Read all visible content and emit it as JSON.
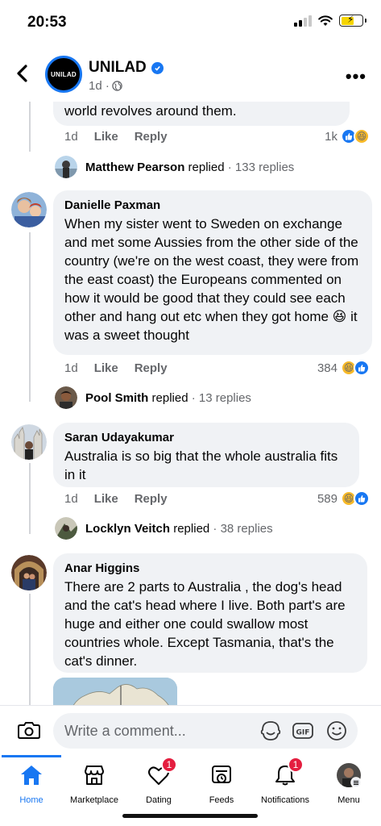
{
  "status_bar": {
    "time": "20:53"
  },
  "header": {
    "page_name": "UNILAD",
    "avatar_text": "UNILAD",
    "meta": "1d ·"
  },
  "comments": [
    {
      "text_fragment": "world revolves around them.",
      "age": "1d",
      "like": "Like",
      "reply": "Reply",
      "reactions_count": "1k",
      "reply_summary": {
        "name": "Matthew Pearson",
        "verb": "replied",
        "count": "· 133 replies"
      }
    },
    {
      "author": "Danielle Paxman",
      "text": "When my sister went to Sweden on exchange and met some Aussies from the other side of the country (we're on the west coast, they were from the east coast) the Europeans commented on how it would be good that they could see each other and hang out etc when they got home 😆 it was a sweet thought",
      "age": "1d",
      "like": "Like",
      "reply": "Reply",
      "reactions_count": "384",
      "reply_summary": {
        "name": "Pool Smith",
        "verb": "replied",
        "count": "· 13 replies"
      }
    },
    {
      "author": "Saran Udayakumar",
      "text": "Australia is so big that the whole australia fits in it",
      "age": "1d",
      "like": "Like",
      "reply": "Reply",
      "reactions_count": "589",
      "reply_summary": {
        "name": "Locklyn Veitch",
        "verb": "replied",
        "count": "· 38 replies"
      }
    },
    {
      "author": "Anar Higgins",
      "text": "There are 2 parts to Australia , the dog's head and the cat's head where I live. Both part's are huge and either one could swallow most countries whole. Except Tasmania, that's the cat's dinner."
    }
  ],
  "comment_bar": {
    "placeholder": "Write a comment..."
  },
  "nav": {
    "items": [
      {
        "label": "Home"
      },
      {
        "label": "Marketplace"
      },
      {
        "label": "Dating",
        "badge": "1"
      },
      {
        "label": "Feeds"
      },
      {
        "label": "Notifications",
        "badge": "1"
      },
      {
        "label": "Menu"
      }
    ]
  },
  "colors": {
    "accent": "#1877f2",
    "badge": "#e41e3f",
    "bubble": "#f0f2f5",
    "muted": "#65676b"
  }
}
